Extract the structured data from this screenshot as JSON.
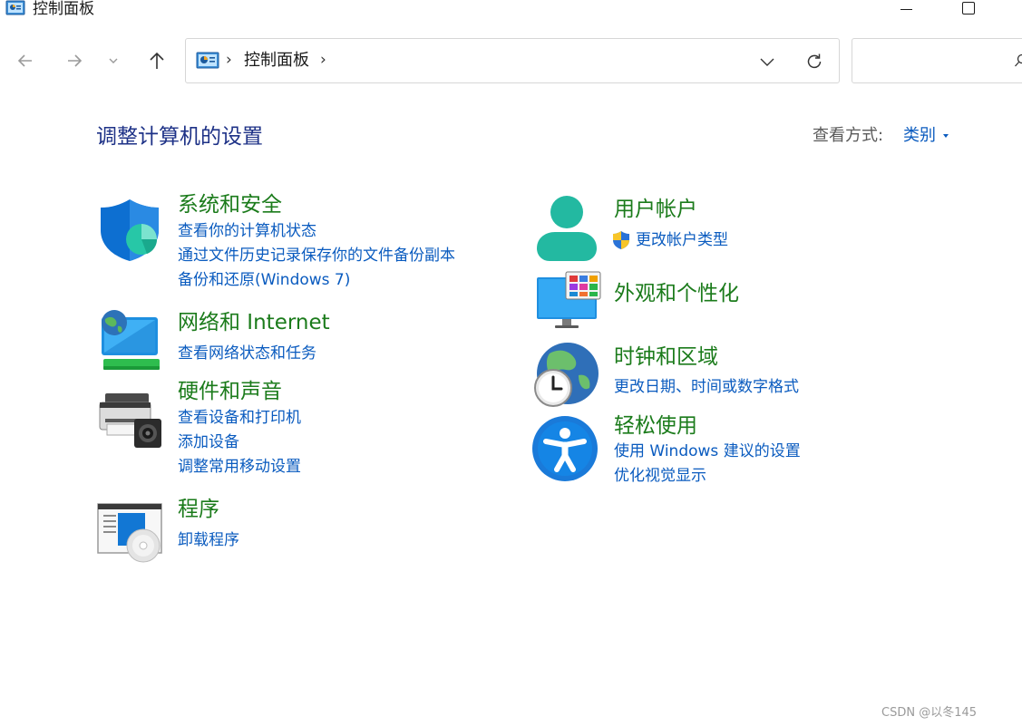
{
  "window": {
    "title": "控制面板",
    "icon": "control-panel-icon"
  },
  "nav": {
    "back_icon": "back-arrow-icon",
    "forward_icon": "forward-arrow-icon",
    "recent_icon": "chevron-down-icon",
    "up_icon": "up-arrow-icon"
  },
  "address": {
    "crumb": "控制面板",
    "separator": "›"
  },
  "search": {
    "placeholder": ""
  },
  "header": {
    "title": "调整计算机的设置",
    "view_label": "查看方式:",
    "view_value": "类别"
  },
  "categories": {
    "system_security": {
      "title": "系统和安全",
      "icon": "shield-icon",
      "links": [
        "查看你的计算机状态",
        "通过文件历史记录保存你的文件备份副本",
        "备份和还原(Windows 7)"
      ]
    },
    "network": {
      "title": "网络和 Internet",
      "icon": "network-globe-icon",
      "links": [
        "查看网络状态和任务"
      ]
    },
    "hardware": {
      "title": "硬件和声音",
      "icon": "printer-speaker-icon",
      "links": [
        "查看设备和打印机",
        "添加设备",
        "调整常用移动设置"
      ]
    },
    "programs": {
      "title": "程序",
      "icon": "programs-disc-icon",
      "links": [
        "卸载程序"
      ]
    },
    "user_accounts": {
      "title": "用户帐户",
      "icon": "user-icon",
      "links": [
        "更改帐户类型"
      ]
    },
    "appearance": {
      "title": "外观和个性化",
      "icon": "monitor-personalize-icon",
      "links": []
    },
    "clock_region": {
      "title": "时钟和区域",
      "icon": "clock-globe-icon",
      "links": [
        "更改日期、时间或数字格式"
      ]
    },
    "ease_access": {
      "title": "轻松使用",
      "icon": "accessibility-icon",
      "links": [
        "使用 Windows 建议的设置",
        "优化视觉显示"
      ]
    }
  },
  "watermark": "CSDN @以冬145",
  "colors": {
    "title_blue": "#1e3287",
    "link_blue": "#0a5bbf",
    "category_green": "#1b7b1b"
  }
}
